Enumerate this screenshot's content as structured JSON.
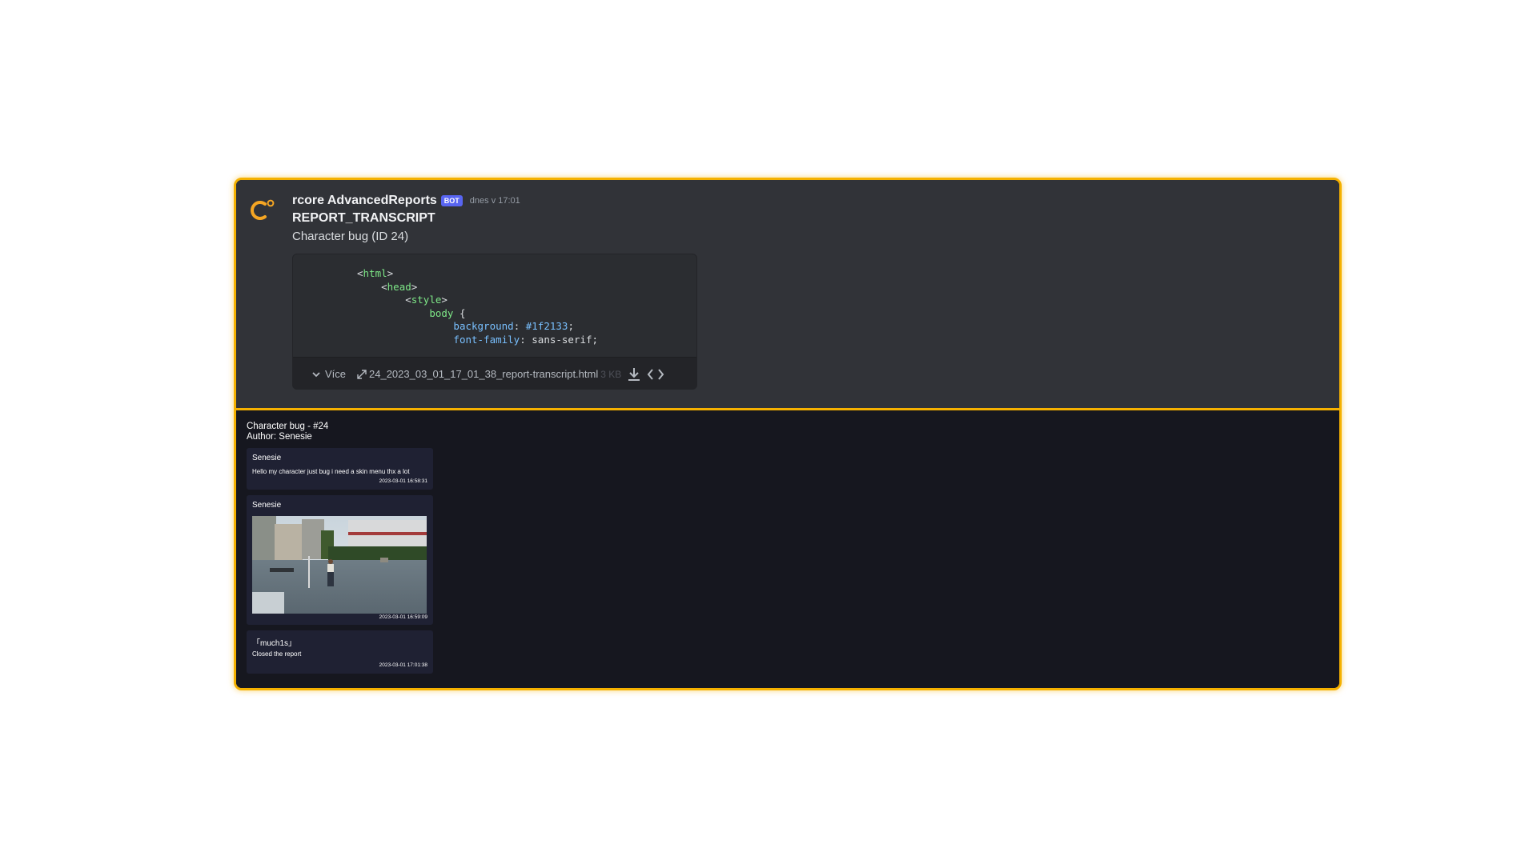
{
  "message": {
    "username": "rcore AdvancedReports",
    "bot_tag": "BOT",
    "timestamp": "dnes v 17:01",
    "title": "REPORT_TRANSCRIPT",
    "subtitle": "Character bug (ID 24)"
  },
  "code_preview": {
    "lines": [
      {
        "indent": "",
        "tag": "html"
      },
      {
        "indent": "    ",
        "tag": "head"
      },
      {
        "indent": "        ",
        "tag": "style"
      }
    ],
    "selector": "body",
    "brace": "{",
    "prop1": "background",
    "val1": "#1f2133",
    "prop2": "font-family",
    "val2": "sans-serif"
  },
  "attachment": {
    "expand_label": "Více",
    "filename": "24_2023_03_01_17_01_38_report-transcript.html",
    "filesize": "3 KB"
  },
  "transcript": {
    "title": "Character bug - #24",
    "author_line": "Author: Senesie",
    "messages": [
      {
        "author": "Senesie",
        "text": "Hello my character just bug i need a skin menu thx a lot",
        "time": "2023-03-01 16:58:31"
      },
      {
        "author": "Senesie",
        "text": "",
        "time": "2023-03-01 16:59:09"
      },
      {
        "author": "「much1s」",
        "text": "Closed the report",
        "time": "2023-03-01 17:01:38"
      }
    ]
  },
  "colors": {
    "accent_border": "#f5b100",
    "discord_bg": "#313338",
    "transcript_bg": "#16171f",
    "card_bg": "#1f2133",
    "bot_tag": "#5865f2"
  },
  "icons": [
    "logo-icon",
    "chevron-down-icon",
    "expand-icon",
    "download-icon",
    "code-icon"
  ]
}
